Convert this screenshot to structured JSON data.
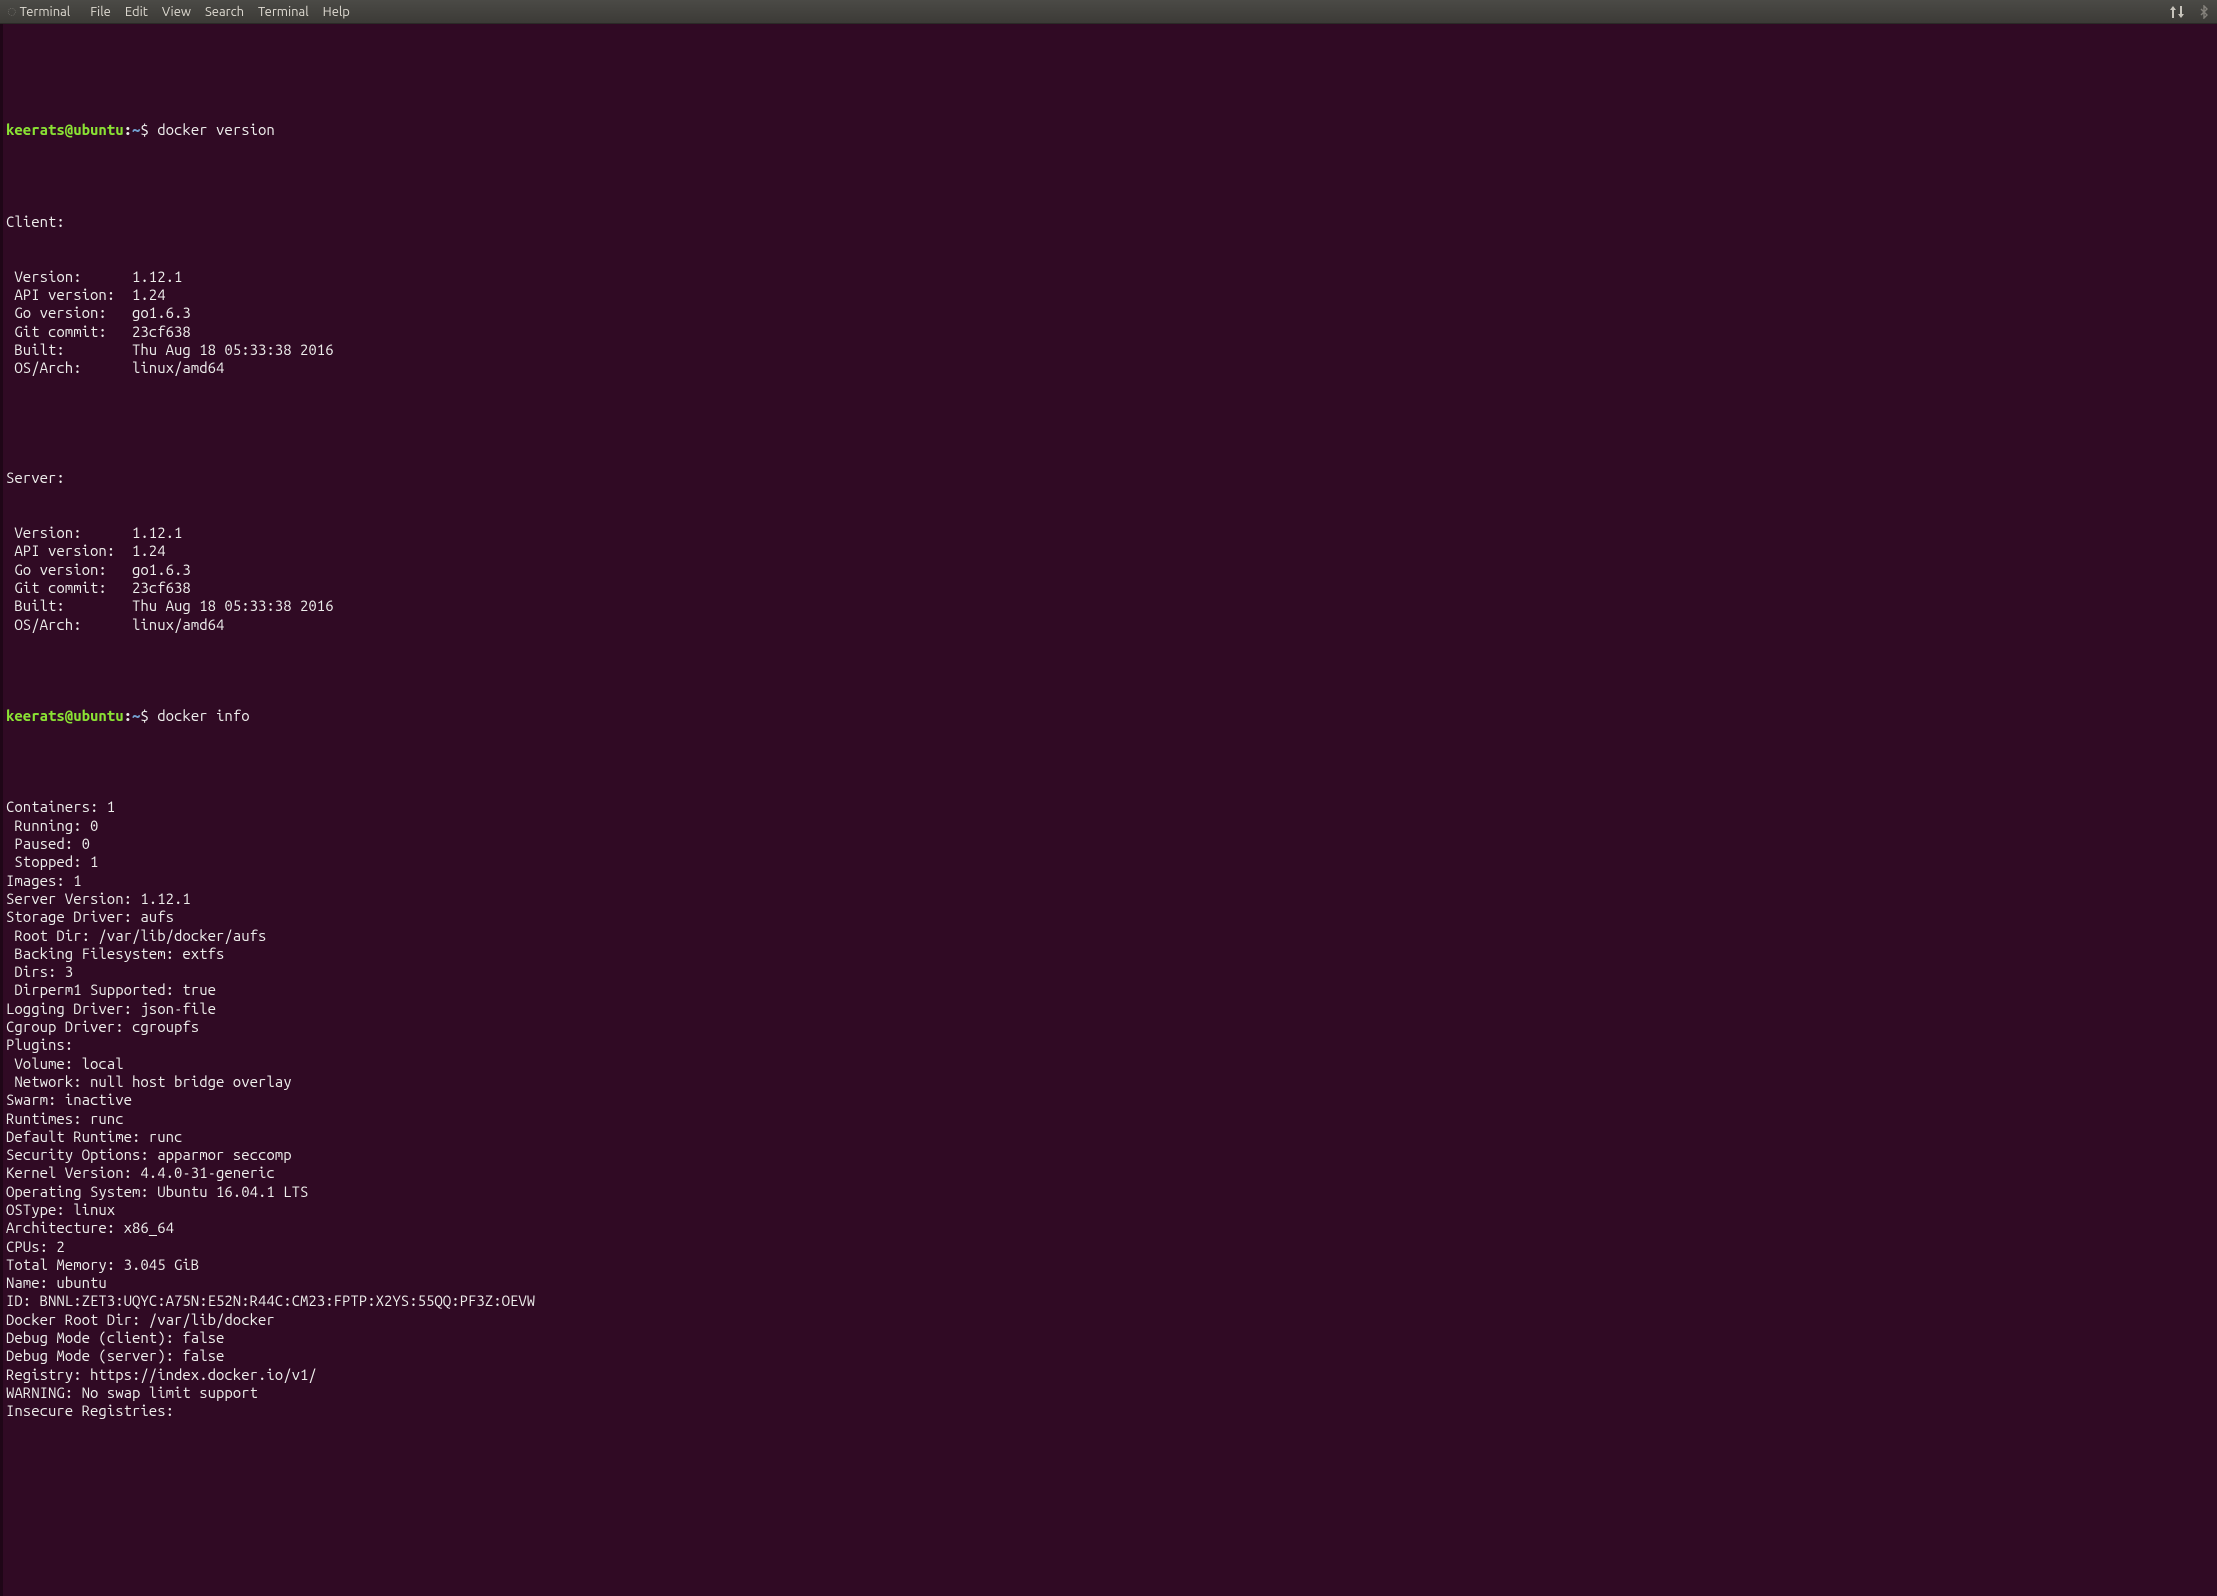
{
  "menubar": {
    "app_title": "Terminal",
    "items": [
      "File",
      "Edit",
      "View",
      "Search",
      "Terminal",
      "Help"
    ]
  },
  "prompt": {
    "user_host": "keerats@ubuntu",
    "colon": ":",
    "path": "~",
    "sigil": "$"
  },
  "cmd1": "docker version",
  "cmd2": "docker info",
  "version": {
    "client_hdr": "Client:",
    "server_hdr": "Server:",
    "rows_client": [
      {
        "k": " Version:",
        "v": "1.12.1"
      },
      {
        "k": " API version:",
        "v": "1.24"
      },
      {
        "k": " Go version:",
        "v": "go1.6.3"
      },
      {
        "k": " Git commit:",
        "v": "23cf638"
      },
      {
        "k": " Built:",
        "v": "Thu Aug 18 05:33:38 2016"
      },
      {
        "k": " OS/Arch:",
        "v": "linux/amd64"
      }
    ],
    "rows_server": [
      {
        "k": " Version:",
        "v": "1.12.1"
      },
      {
        "k": " API version:",
        "v": "1.24"
      },
      {
        "k": " Go version:",
        "v": "go1.6.3"
      },
      {
        "k": " Git commit:",
        "v": "23cf638"
      },
      {
        "k": " Built:",
        "v": "Thu Aug 18 05:33:38 2016"
      },
      {
        "k": " OS/Arch:",
        "v": "linux/amd64"
      }
    ]
  },
  "info_lines": [
    "Containers: 1",
    " Running: 0",
    " Paused: 0",
    " Stopped: 1",
    "Images: 1",
    "Server Version: 1.12.1",
    "Storage Driver: aufs",
    " Root Dir: /var/lib/docker/aufs",
    " Backing Filesystem: extfs",
    " Dirs: 3",
    " Dirperm1 Supported: true",
    "Logging Driver: json-file",
    "Cgroup Driver: cgroupfs",
    "Plugins:",
    " Volume: local",
    " Network: null host bridge overlay",
    "Swarm: inactive",
    "Runtimes: runc",
    "Default Runtime: runc",
    "Security Options: apparmor seccomp",
    "Kernel Version: 4.4.0-31-generic",
    "Operating System: Ubuntu 16.04.1 LTS",
    "OSType: linux",
    "Architecture: x86_64",
    "CPUs: 2",
    "Total Memory: 3.045 GiB",
    "Name: ubuntu",
    "ID: BNNL:ZET3:UQYC:A75N:E52N:R44C:CM23:FPTP:X2YS:55QQ:PF3Z:OEVW",
    "Docker Root Dir: /var/lib/docker",
    "Debug Mode (client): false",
    "Debug Mode (server): false",
    "Registry: https://index.docker.io/v1/",
    "WARNING: No swap limit support",
    "Insecure Registries:"
  ]
}
